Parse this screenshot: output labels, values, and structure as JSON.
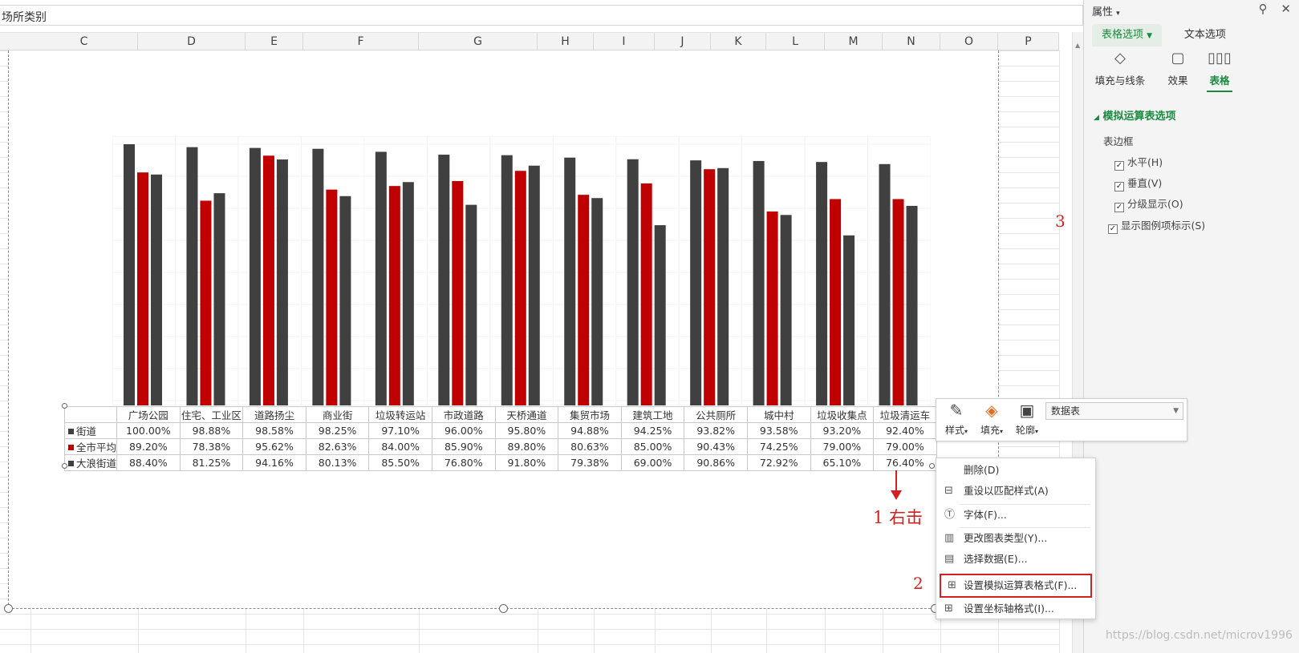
{
  "formula_bar": {
    "text": "场所类别"
  },
  "columns": [
    "C",
    "D",
    "E",
    "F",
    "G",
    "H",
    "I",
    "J",
    "K",
    "L",
    "M",
    "N",
    "O",
    "P"
  ],
  "panel": {
    "title": "属性",
    "tabs": [
      "表格选项",
      "文本选项"
    ],
    "subtabs": [
      "填充与线条",
      "效果",
      "表格"
    ],
    "section": "模拟运算表选项",
    "border_label": "表边框",
    "options": [
      {
        "label": "水平(H)",
        "checked": true
      },
      {
        "label": "垂直(V)",
        "checked": true
      },
      {
        "label": "分级显示(O)",
        "checked": true
      },
      {
        "label": "显示图例项标示(S)",
        "checked": true
      }
    ]
  },
  "mini_toolbar": {
    "buttons": [
      "样式",
      "填充",
      "轮廓"
    ],
    "select_value": "数据表"
  },
  "context_menu": [
    {
      "label": "删除(D)",
      "icon": "none"
    },
    {
      "label": "重设以匹配样式(A)",
      "icon": "reset-icon"
    },
    {
      "label": "字体(F)...",
      "icon": "font-icon"
    },
    {
      "label": "更改图表类型(Y)...",
      "icon": "chart-type-icon"
    },
    {
      "label": "选择数据(E)...",
      "icon": "select-data-icon"
    },
    {
      "label": "设置模拟运算表格式(F)...",
      "icon": "format-table-icon"
    },
    {
      "label": "设置坐标轴格式(I)...",
      "icon": "format-axis-icon"
    }
  ],
  "annotations": {
    "step1": "1 右击",
    "step2": "2",
    "step3": "3"
  },
  "watermark": "https://blog.csdn.net/microv1996",
  "colors": {
    "dark": "#404040",
    "red": "#c00000",
    "accent": "#1a8a3f",
    "annotation": "#d42020"
  },
  "chart_data": {
    "type": "bar",
    "categories": [
      "广场公园",
      "住宅、工业区",
      "道路扬尘",
      "商业街",
      "垃圾转运站",
      "市政道路",
      "天桥通道",
      "集贸市场",
      "建筑工地",
      "公共厕所",
      "城中村",
      "垃圾收集点",
      "垃圾清运车"
    ],
    "series": [
      {
        "name": "街道",
        "values": [
          "100.00%",
          "98.88%",
          "98.58%",
          "98.25%",
          "97.10%",
          "96.00%",
          "95.80%",
          "94.88%",
          "94.25%",
          "93.82%",
          "93.58%",
          "93.20%",
          "92.40%"
        ]
      },
      {
        "name": "全市平均",
        "values": [
          "89.20%",
          "78.38%",
          "95.62%",
          "82.63%",
          "84.00%",
          "85.90%",
          "89.80%",
          "80.63%",
          "85.00%",
          "90.43%",
          "74.25%",
          "79.00%",
          "79.00%"
        ]
      },
      {
        "name": "大浪街道",
        "values": [
          "88.40%",
          "81.25%",
          "94.16%",
          "80.13%",
          "85.50%",
          "76.80%",
          "91.80%",
          "79.38%",
          "69.00%",
          "90.86%",
          "72.92%",
          "65.10%",
          "76.40%"
        ]
      }
    ],
    "ylim": [
      0,
      100
    ]
  }
}
